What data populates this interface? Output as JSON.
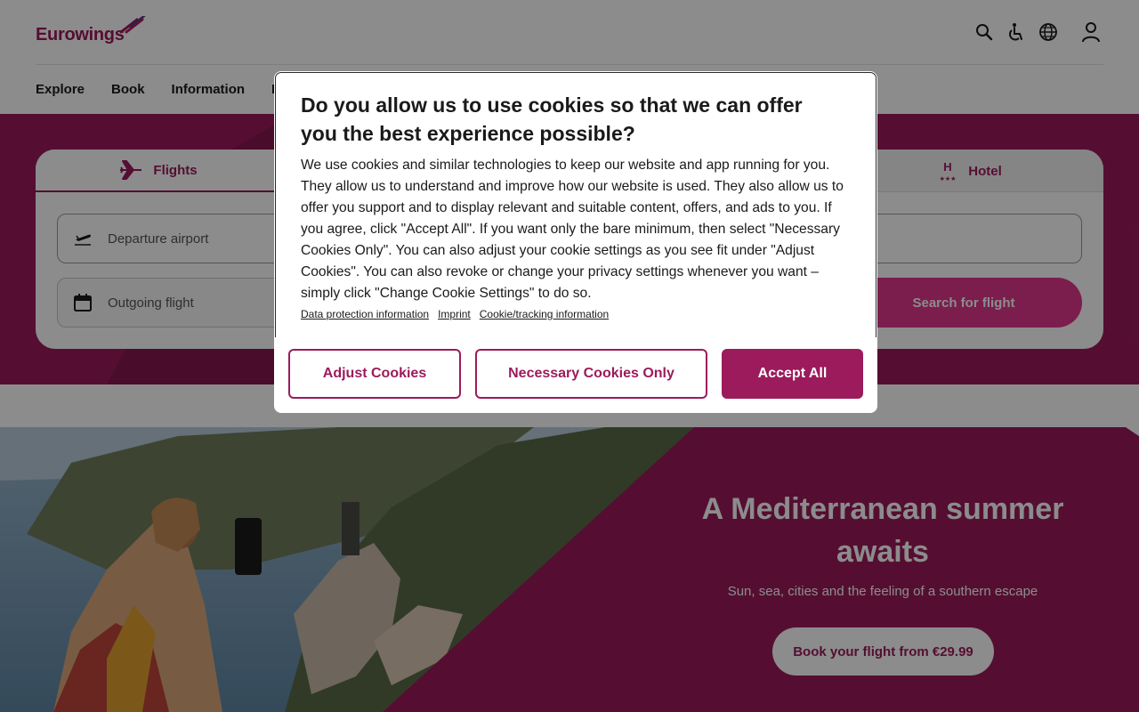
{
  "header": {
    "logo_text": "Eurowings",
    "icons": [
      "search-icon",
      "accessibility-icon",
      "globe-icon",
      "user-icon"
    ]
  },
  "nav": [
    "Explore",
    "Book",
    "Information",
    "Fl"
  ],
  "booking": {
    "tabs": [
      {
        "label": "Flights",
        "icon": "plane-icon",
        "active": true
      },
      {
        "label": "Hotel",
        "icon": "hotel-icon",
        "active": false
      }
    ],
    "departure_placeholder": "Departure airport",
    "outgoing_placeholder": "Outgoing flight",
    "search_label": "Search for flight"
  },
  "hero": {
    "title": "A Mediterranean summer awaits",
    "subtitle": "Sun, sea, cities and the feeling of a southern escape",
    "cta": "Book your flight from €29.99"
  },
  "cookie_modal": {
    "title": "Do you allow us to use cookies so that we can offer you the best experience possible?",
    "body": "We use cookies and similar technologies to keep our website and app running for you. They allow us to understand and improve how our website is used. They also allow us to offer you support and to display relevant and suitable content, offers, and ads to you. If you agree, click \"Accept All\". If you want only the bare minimum, then select \"Necessary Cookies Only\". You can also adjust your cookie settings as you see fit under \"Adjust Cookies\". You can also revoke or change your privacy settings whenever you want – simply click \"Change Cookie Settings\" to do so.",
    "links": [
      "Data protection information",
      "Imprint",
      "Cookie/tracking information"
    ],
    "buttons": {
      "adjust": "Adjust Cookies",
      "necessary": "Necessary Cookies Only",
      "accept": "Accept All"
    }
  },
  "colors": {
    "brand": "#9b1b5c",
    "brand_bright": "#e0358c"
  }
}
